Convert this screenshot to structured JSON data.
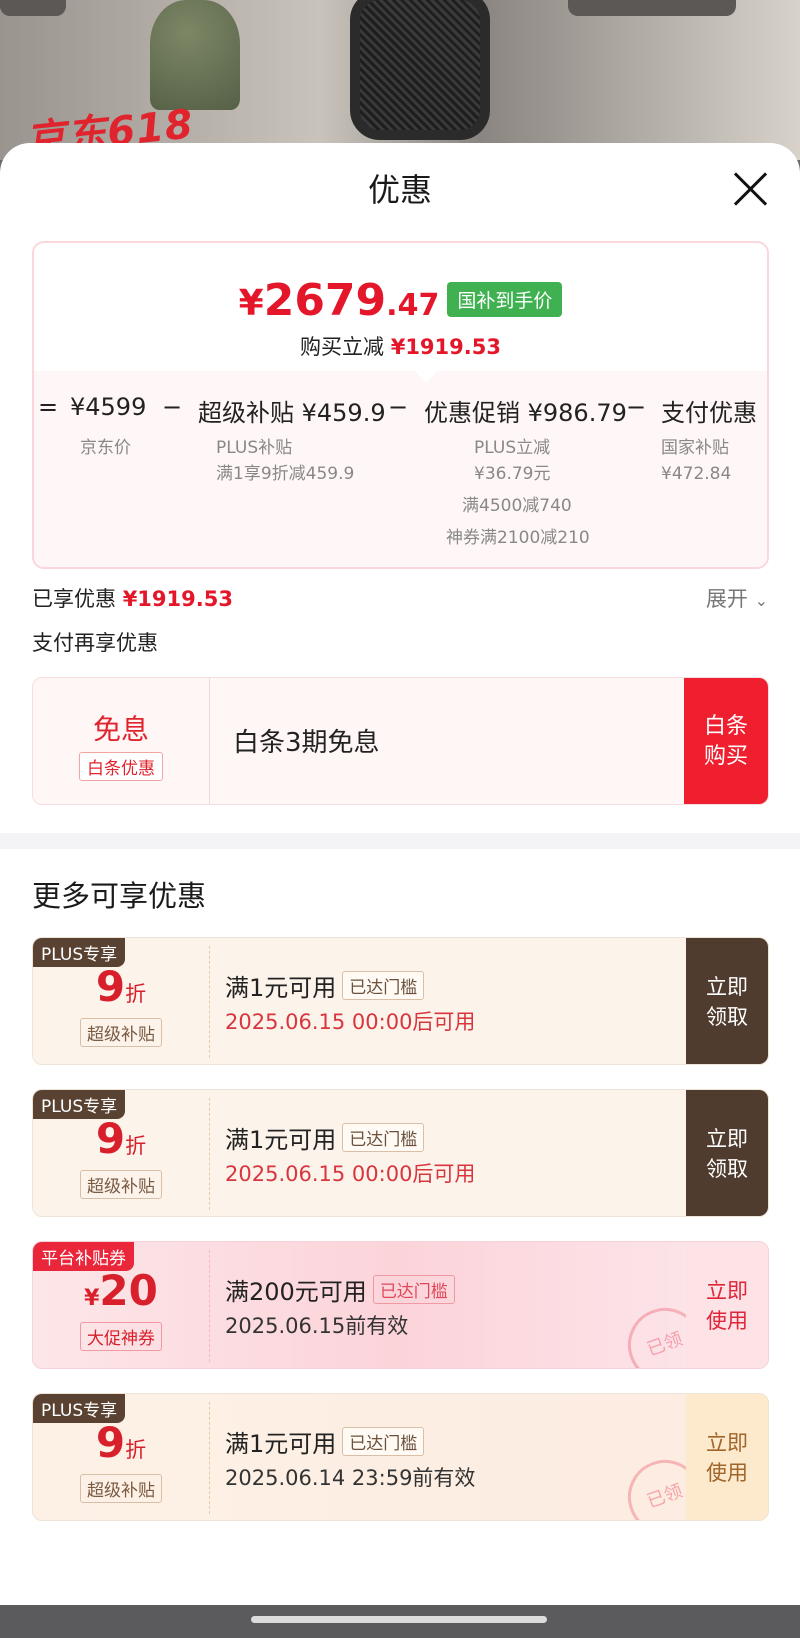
{
  "background": {
    "promo_text": "京东618"
  },
  "sheet": {
    "title": "优惠"
  },
  "price_summary": {
    "currency": "¥",
    "price_int": "2679",
    "price_dec": ".47",
    "price_tag": "国补到手价",
    "reduce_label": "购买立减",
    "reduce_value": "¥1919.53",
    "formula": [
      {
        "op": "=",
        "main": "¥4599",
        "subs": [
          "京东价"
        ]
      },
      {
        "op": "−",
        "main": "超级补贴 ¥459.9",
        "subs": [
          "PLUS补贴",
          "满1享9折减459.9"
        ]
      },
      {
        "op": "−",
        "main": "优惠促销 ¥986.79",
        "subs": [
          "PLUS立减",
          "¥36.79元",
          "满4500减740",
          "神券满2100减210"
        ]
      },
      {
        "op": "−",
        "main": "支付优惠",
        "subs": [
          "国家补贴",
          "¥472.84"
        ]
      }
    ]
  },
  "enjoyed": {
    "label": "已享优惠",
    "value": "¥1919.53",
    "expand": "展开"
  },
  "pay_more": {
    "label": "支付再享优惠"
  },
  "baitiao": {
    "title": "免息",
    "tag": "白条优惠",
    "desc": "白条3期免息",
    "button": "白条购买"
  },
  "more": {
    "title": "更多可享优惠"
  },
  "coupons": [
    {
      "label": "PLUS专享",
      "num": "9",
      "unit": "折",
      "sub": "超级补贴",
      "cond": "满1元可用",
      "chip": "已达门槛",
      "time": "2025.06.15 00:00后可用",
      "action": "立即领取"
    },
    {
      "label": "PLUS专享",
      "num": "9",
      "unit": "折",
      "sub": "超级补贴",
      "cond": "满1元可用",
      "chip": "已达门槛",
      "time": "2025.06.15 00:00后可用",
      "action": "立即领取"
    },
    {
      "label": "平台补贴券",
      "yen": "¥",
      "num": "20",
      "sub": "大促神券",
      "cond": "满200元可用",
      "chip": "已达门槛",
      "time": "2025.06.15前有效",
      "action": "立即使用",
      "stamp": "已领"
    },
    {
      "label": "PLUS专享",
      "num": "9",
      "unit": "折",
      "sub": "超级补贴",
      "cond": "满1元可用",
      "chip": "已达门槛",
      "time": "2025.06.14 23:59前有效",
      "action": "立即使用",
      "stamp": "已领"
    }
  ],
  "colors": {
    "accent_red": "#e4162a",
    "green_tag": "#3fb151",
    "brown_btn": "#4f3c2e"
  }
}
